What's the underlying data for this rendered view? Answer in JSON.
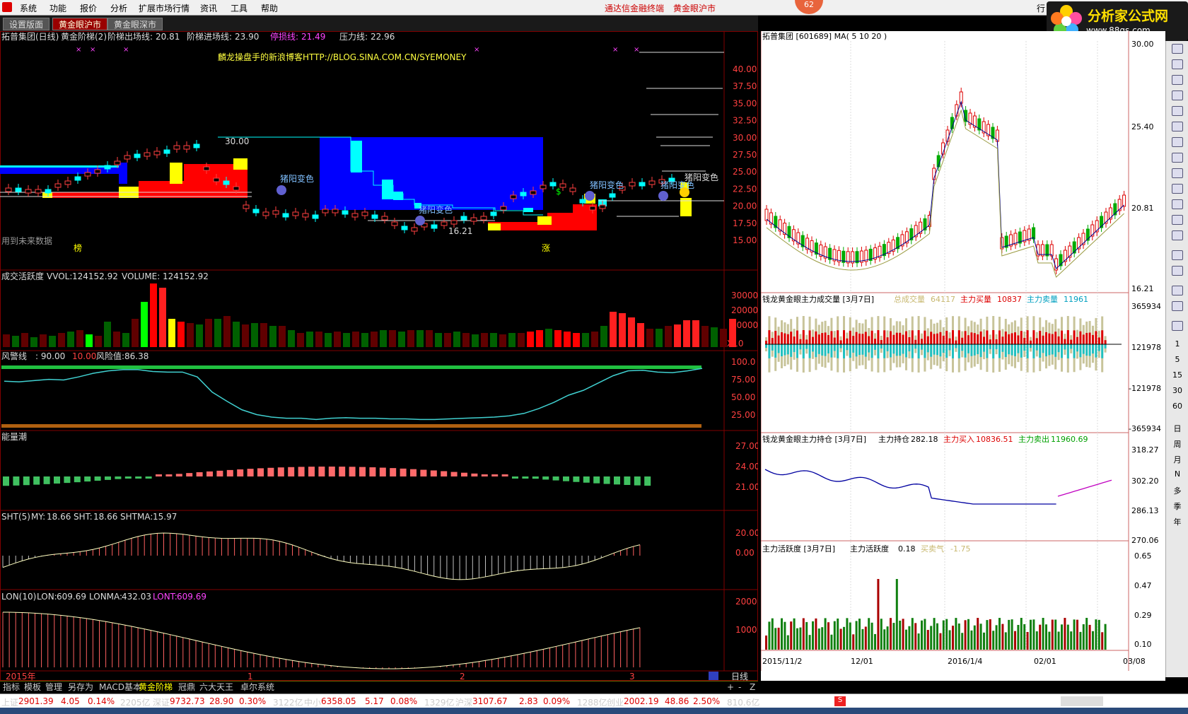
{
  "menu": {
    "items": [
      "系统",
      "功能",
      "报价",
      "分析",
      "扩展市场行情",
      "资讯",
      "工具",
      "帮助"
    ],
    "center_title": "通达信金融终端",
    "center_sub": "黄金眼沪市",
    "badge": "62",
    "right_label": "行"
  },
  "brand": {
    "text": "分析家公式网",
    "url_text": "www.88gs.com"
  },
  "tabs": [
    "设置版面",
    "黄金眼沪市",
    "黄金眼深市"
  ],
  "main": {
    "header": {
      "name": "拓普集团(日线)",
      "indicator": "黄金阶梯(2)",
      "exit_label": "阶梯出场线:",
      "exit_val": "20.81",
      "enter_label": "阶梯进场线:",
      "enter_val": "23.90",
      "stop_label": "停损线:",
      "stop_val": "21.49",
      "pressure_label": "压力线:",
      "pressure_val": "22.96"
    },
    "blog": "麟龙操盘手的新浪博客HTTP://BLOG.SINA.COM.CN/SYEMONEY",
    "yticks": [
      "40.00",
      "37.50",
      "35.00",
      "32.50",
      "30.00",
      "27.50",
      "25.00",
      "22.50",
      "20.00",
      "17.50",
      "15.00"
    ],
    "annot": {
      "high": "30.00",
      "low": "16.21",
      "zhuyang": "猪阳变色",
      "future": "用到未来数据",
      "bang": "榜",
      "zhang": "涨",
      "dollar": "$"
    }
  },
  "vol": {
    "label": "成交活跃度",
    "vvol_label": "VVOL:",
    "vvol": "124152.92",
    "volume_label": "VOLUME:",
    "volume": "124152.92",
    "yticks": [
      "30000",
      "20000",
      "10000"
    ],
    "unit": "X10"
  },
  "risk": {
    "label": "风警线",
    "v1": ": 90.00",
    "v2": "10.00",
    "risk_label": "风险值:",
    "risk_val": "86.38",
    "yticks": [
      "100.0",
      "75.00",
      "50.00",
      "25.00"
    ]
  },
  "energy": {
    "label": "能量潮",
    "yticks": [
      "27.00",
      "24.00",
      "21.00"
    ]
  },
  "sht": {
    "label": "SHT(5)",
    "my_label": "MY:",
    "my": "18.66",
    "sht_label": "SHT:",
    "sht": "18.66",
    "shtma_label": "SHTMA:",
    "shtma": "15.97",
    "yticks": [
      "20.00",
      "0.00"
    ]
  },
  "lon": {
    "label": "LON(10)",
    "lon_label": "LON:",
    "lon": "609.69",
    "lonma_label": "LONMA:",
    "lonma": "432.03",
    "lont_label": "LONT:",
    "lont": "609.69",
    "yticks": [
      "2000",
      "1000"
    ]
  },
  "xaxis": {
    "year": "2015年",
    "m1": "1",
    "m2": "2",
    "m3": "3",
    "period": "日线"
  },
  "right": {
    "kline_header": "拓普集团 [601689] MA( 5 10 20 )",
    "kline_yticks": [
      "30.00",
      "25.40",
      "20.81",
      "16.21"
    ],
    "vol_header": "钱龙黄金眼主力成交量 [3月7日]",
    "vol_total_label": "总成交量",
    "vol_total": "64117",
    "vol_buy_label": "主力买量",
    "vol_buy": "10837",
    "vol_sell_label": "主力卖量",
    "vol_sell": "11961",
    "vol_yticks": [
      "365934",
      "121978",
      "-121978",
      "-365934"
    ],
    "hold_header": "钱龙黄金眼主力持仓 [3月7日]",
    "hold_label": "主力持仓",
    "hold_val": "282.18",
    "hold_buy_label": "主力买入",
    "hold_buy": "10836.51",
    "hold_sell_label": "主力卖出",
    "hold_sell": "11960.69",
    "hold_yticks": [
      "318.27",
      "302.20",
      "286.13",
      "270.06"
    ],
    "act_header": "主力活跃度 [3月7日]",
    "act_label": "主力活跃度",
    "act_val": "0.18",
    "act_bs_label": "买卖气",
    "act_bs": "-1.75",
    "act_yticks": [
      "0.65",
      "0.47",
      "0.29",
      "0.10"
    ],
    "xdates": [
      "2015/11/2",
      "12/01",
      "2016/1/4",
      "02/01",
      "03/08"
    ]
  },
  "sidebar": {
    "labels": [
      "1",
      "5",
      "15",
      "30",
      "60",
      "日",
      "周",
      "月",
      "N",
      "多",
      "季",
      "年"
    ]
  },
  "bottom_tabs": [
    "指标",
    "模板",
    "管理",
    "另存为",
    "MACD基本",
    "黄金阶梯",
    "冠鼎",
    "六大天王",
    "卓尔系统"
  ],
  "bottom_ctrl": [
    "+",
    "-",
    "Z"
  ],
  "status": [
    {
      "name": "上证",
      "val": "2901.39",
      "chg": "4.05",
      "pct": "0.14%",
      "amt": "2205亿"
    },
    {
      "name": "深证",
      "val": "9732.73",
      "chg": "28.90",
      "pct": "0.30%",
      "amt": "3122亿"
    },
    {
      "name": "中小",
      "val": "6358.05",
      "chg": "5.17",
      "pct": "0.08%",
      "amt": "1329亿"
    },
    {
      "name": "沪深",
      "val": "3107.67",
      "chg": "2.83",
      "pct": "0.09%",
      "amt": "1288亿"
    },
    {
      "name": "创业",
      "val": "2002.19",
      "chg": "48.86",
      "pct": "2.50%",
      "amt": "810.6亿"
    }
  ],
  "colors": {
    "up": "#ff2020",
    "down": "#00c000",
    "cyan": "#00ffff",
    "blue": "#0000ff",
    "yellow": "#ffff00",
    "grid": "#800000"
  }
}
